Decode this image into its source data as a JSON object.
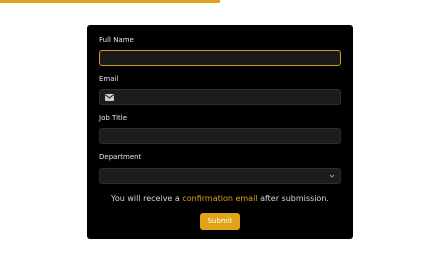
{
  "form": {
    "full_name": {
      "label": "Full Name",
      "value": ""
    },
    "email": {
      "label": "Email",
      "value": "",
      "icon": "mail-icon"
    },
    "job_title": {
      "label": "Job Title",
      "value": ""
    },
    "department": {
      "label": "Department",
      "value": "",
      "icon": "chevron-down-icon"
    },
    "info_before": "You will receive a ",
    "info_link": "confirmation email",
    "info_after": " after submission.",
    "submit_label": "Submit"
  },
  "colors": {
    "accent": "#e0a31a",
    "card_background": "#000000",
    "field_background": "#1c1c1c"
  }
}
